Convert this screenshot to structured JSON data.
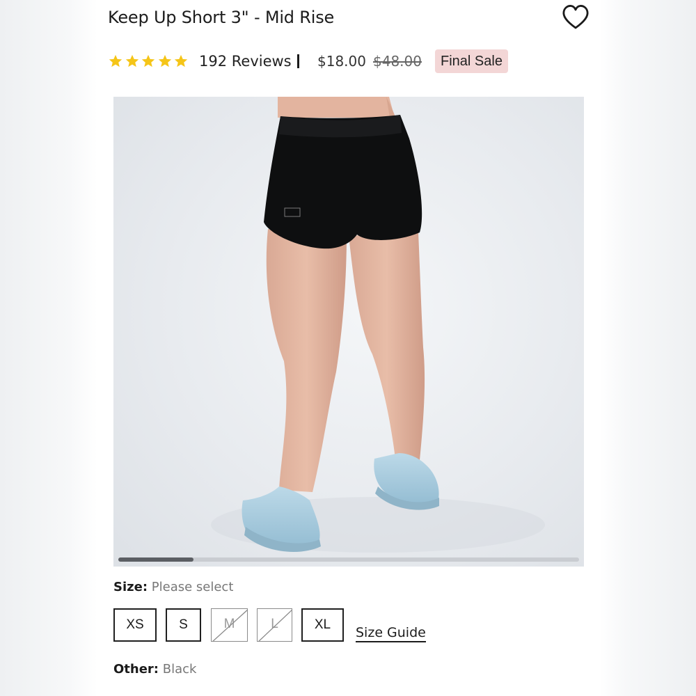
{
  "product": {
    "title": "Keep Up Short 3\" - Mid Rise",
    "rating_stars": 5,
    "reviews": "192 Reviews",
    "divider": "|",
    "price": "$18.00",
    "compare_price": "$48.00",
    "badge": "Final Sale"
  },
  "gallery": {
    "scroll_position": 0.16
  },
  "options": {
    "size_label": "Size:",
    "size_value": "Please select",
    "sizes": [
      {
        "label": "XS",
        "available": true
      },
      {
        "label": "S",
        "available": true
      },
      {
        "label": "M",
        "available": false
      },
      {
        "label": "L",
        "available": false
      },
      {
        "label": "XL",
        "available": true
      }
    ],
    "size_guide": "Size Guide",
    "other_label": "Other:",
    "other_value": "Black"
  },
  "colors": {
    "star": "#f5c518",
    "badge_bg": "#f3d6d6",
    "shorts": "#0e0f10",
    "sneakers": "#a9cde0"
  },
  "icons": {
    "wishlist": "heart-outline-icon",
    "rating": "star-icon"
  }
}
